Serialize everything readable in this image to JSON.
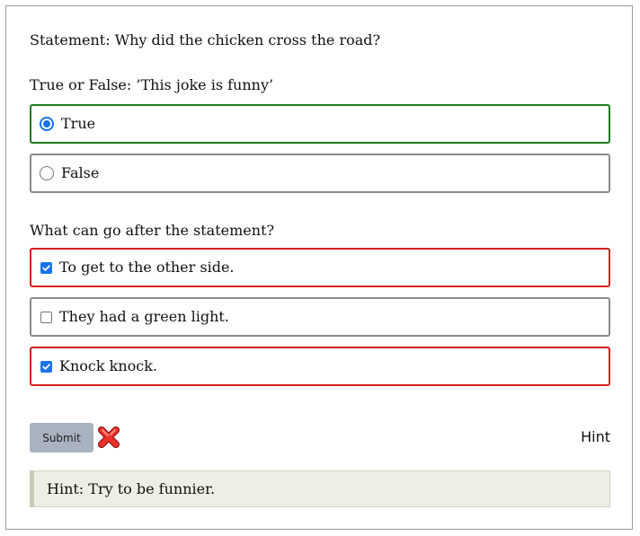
{
  "statement": "Statement: Why did the chicken cross the road?",
  "question1": {
    "title": "True or False: ’This joke is funny’",
    "options": [
      {
        "label": "True",
        "selected": true,
        "status": "correct"
      },
      {
        "label": "False",
        "selected": false,
        "status": "neutral"
      }
    ]
  },
  "question2": {
    "title": "What can go after the statement?",
    "options": [
      {
        "label": "To get to the other side.",
        "checked": true,
        "status": "incorrect"
      },
      {
        "label": "They had a green light.",
        "checked": false,
        "status": "neutral"
      },
      {
        "label": "Knock knock.",
        "checked": true,
        "status": "incorrect"
      }
    ]
  },
  "actions": {
    "submit_label": "Submit",
    "result_icon": "red-x-icon",
    "hint_label": "Hint"
  },
  "hint": {
    "text": "Hint: Try to be funnier."
  },
  "colors": {
    "correct": "#1f7a1f",
    "incorrect": "#d91c1c",
    "neutral": "#8a8a8a",
    "accent": "#1a73e8",
    "submit_bg": "#a9b3bf",
    "hint_bg": "#eeeee4"
  }
}
